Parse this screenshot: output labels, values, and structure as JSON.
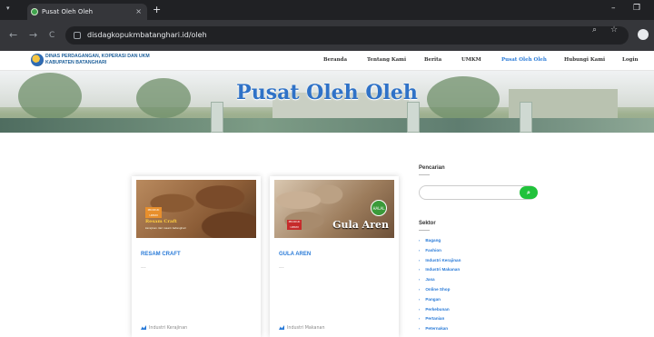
{
  "browser": {
    "tab_title": "Pusat Oleh Oleh",
    "tab_close": "×",
    "new_tab": "+",
    "minimize": "–",
    "restore": "❐",
    "url": "disdagkopukmbatanghari.id/oleh",
    "back": "←",
    "forward": "→",
    "reload": "C"
  },
  "site": {
    "org_line1": "DINAS PERDAGANGAN, KOPERASI DAN UKM",
    "org_line2": "KABUPATEN BATANGHARI",
    "menu": [
      "Beranda",
      "Tentang Kami",
      "Berita",
      "UMKM",
      "Pusat Oleh Oleh",
      "Hubungi Kami",
      "Login"
    ],
    "active_menu": "Pusat Oleh Oleh",
    "accent_color": "#2a7bd8"
  },
  "hero": {
    "title": "Pusat Oleh Oleh"
  },
  "cards": [
    {
      "title": "RESAM CRAFT",
      "excerpt": "...",
      "category": "Industri Kerajinan",
      "image_label": "Resam Craft",
      "image_tag": "PRODUK UMKM",
      "image_sub": "kerajinan dari resam batanghari"
    },
    {
      "title": "GULA AREN",
      "excerpt": "...",
      "category": "Industri Makanan",
      "image_label": "Gula Aren",
      "image_tag": "PRODUK UMKM",
      "image_badge": "HALAL"
    }
  ],
  "sidebar": {
    "search_heading": "Pencarian",
    "search_placeholder": "",
    "sector_heading": "Sektor",
    "sectors": [
      "Bagang",
      "Fashion",
      "Industri Kerajinan",
      "Industri Makanan",
      "Jasa",
      "Online Shop",
      "Pangan",
      "Perkebunan",
      "Pertanian",
      "Peternakan"
    ]
  }
}
